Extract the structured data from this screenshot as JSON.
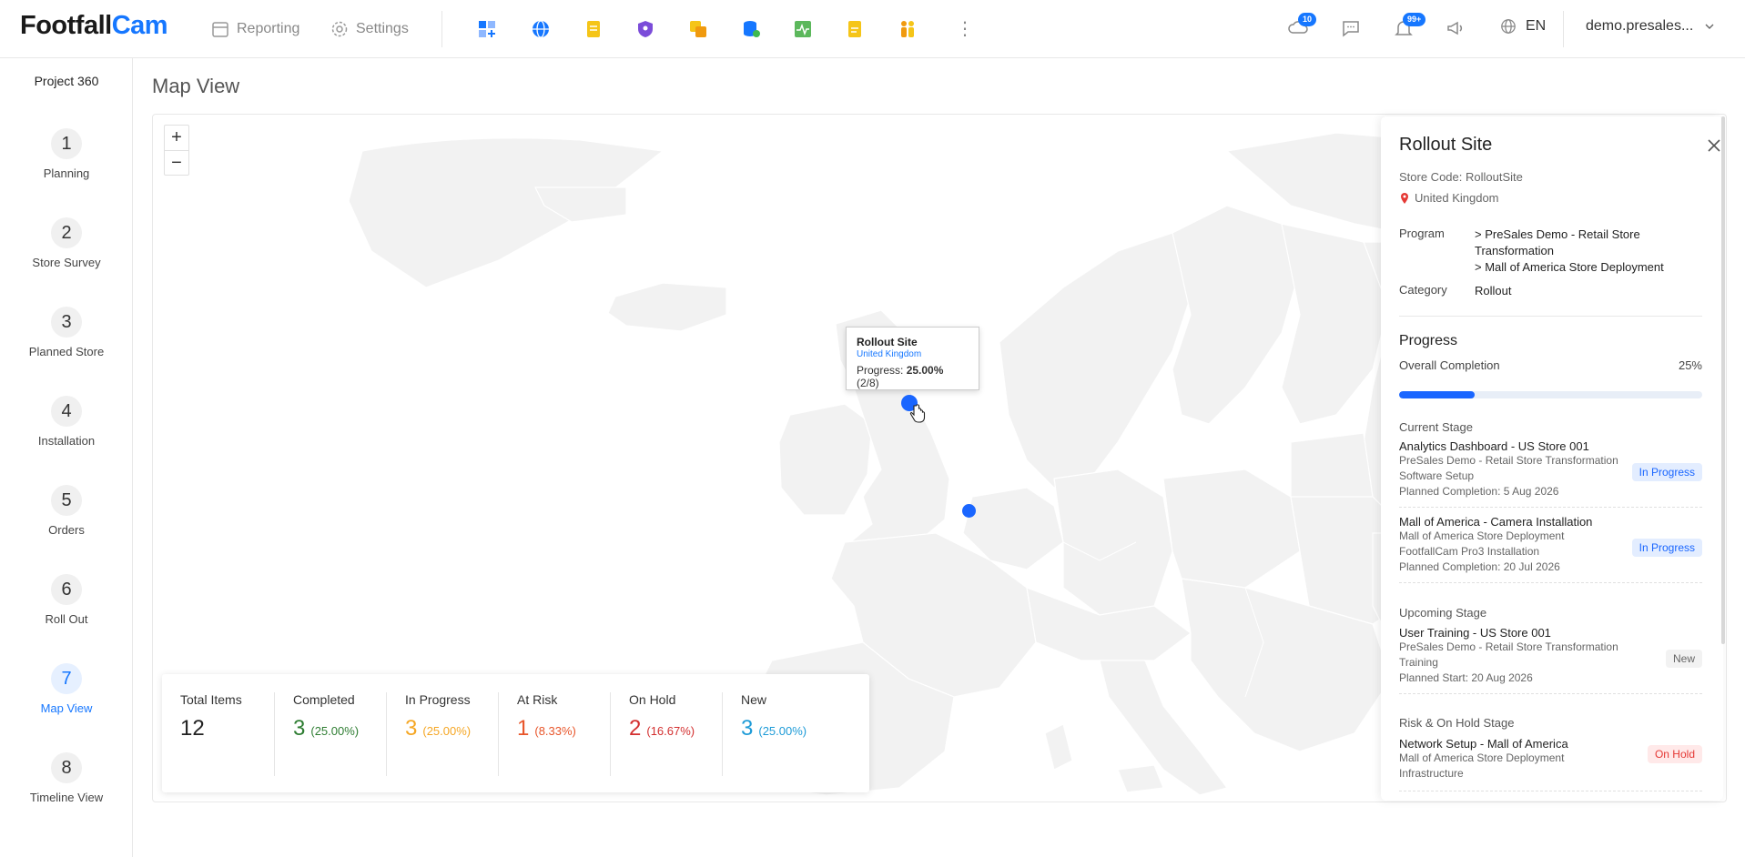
{
  "brand": {
    "part1": "Footfall",
    "part2": "Cam"
  },
  "topnav": {
    "reporting": "Reporting",
    "settings": "Settings",
    "messages_badge": "10",
    "notifications_badge": "99+",
    "language": "EN",
    "user": "demo.presales..."
  },
  "sidebar": {
    "title": "Project 360",
    "steps": [
      {
        "num": "1",
        "label": "Planning"
      },
      {
        "num": "2",
        "label": "Store Survey"
      },
      {
        "num": "3",
        "label": "Planned Store"
      },
      {
        "num": "4",
        "label": "Installation"
      },
      {
        "num": "5",
        "label": "Orders"
      },
      {
        "num": "6",
        "label": "Roll Out"
      },
      {
        "num": "7",
        "label": "Map View"
      },
      {
        "num": "8",
        "label": "Timeline View"
      }
    ]
  },
  "page": {
    "title": "Map View"
  },
  "map": {
    "zoom_in": "+",
    "zoom_out": "−",
    "tooltip": {
      "title": "Rollout Site",
      "country": "United Kingdom",
      "progress_label": "Progress:",
      "progress_value": "25.00%",
      "progress_count": "(2/8)"
    }
  },
  "stats": [
    {
      "label": "Total Items",
      "value": "12",
      "pct": "",
      "color": "#222222"
    },
    {
      "label": "Completed",
      "value": "3",
      "pct": "(25.00%)",
      "color": "#2e7d32"
    },
    {
      "label": "In Progress",
      "value": "3",
      "pct": "(25.00%)",
      "color": "#f5a623"
    },
    {
      "label": "At Risk",
      "value": "1",
      "pct": "(8.33%)",
      "color": "#e8552a"
    },
    {
      "label": "On Hold",
      "value": "2",
      "pct": "(16.67%)",
      "color": "#d32f2f"
    },
    {
      "label": "New",
      "value": "3",
      "pct": "(25.00%)",
      "color": "#1e9bd7"
    }
  ],
  "panel": {
    "title": "Rollout Site",
    "store_code": "Store Code: RolloutSite",
    "location": "United Kingdom",
    "program_label": "Program",
    "program_1": "> PreSales Demo - Retail Store Transformation",
    "program_2": "> Mall of America Store Deployment",
    "category_label": "Category",
    "category_value": "Rollout",
    "progress_title": "Progress",
    "overall_label": "Overall Completion",
    "overall_pct": "25%",
    "overall_fraction": 0.25,
    "current_stage": "Current Stage",
    "upcoming_stage": "Upcoming Stage",
    "risk_stage": "Risk & On Hold Stage",
    "stages_current": [
      {
        "title": "Analytics Dashboard - US Store 001",
        "line1": "PreSales Demo - Retail Store Transformation",
        "line2": "Software Setup",
        "date": "Planned Completion: 5 Aug 2026",
        "badge": "In Progress"
      },
      {
        "title": "Mall of America - Camera Installation",
        "line1": "Mall of America Store Deployment",
        "line2": "FootfallCam Pro3 Installation",
        "date": "Planned Completion: 20 Jul 2026",
        "badge": "In Progress"
      }
    ],
    "stages_upcoming": [
      {
        "title": "User Training - US Store 001",
        "line1": "PreSales Demo - Retail Store Transformation",
        "line2": "Training",
        "date": "Planned Start: 20 Aug 2026",
        "badge": "New"
      }
    ],
    "stages_risk": [
      {
        "title": "Network Setup - Mall of America",
        "line1": "Mall of America Store Deployment",
        "line2": "Infrastructure",
        "badge": "On Hold"
      }
    ]
  },
  "colors": {
    "accent": "#1677ff",
    "marker": "#1a66ff"
  }
}
